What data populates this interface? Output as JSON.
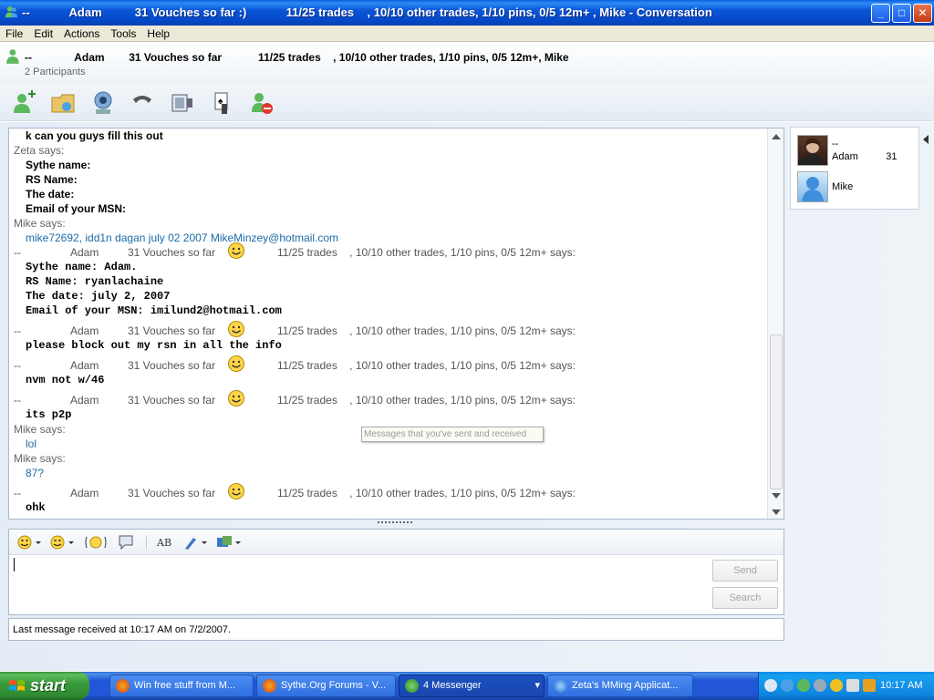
{
  "window": {
    "title": "--            Adam          31 Vouches so far :)            11/25 trades    , 10/10 other trades, 1/10 pins, 0/5 12m+ , Mike - Conversation",
    "controls": {
      "minimize": "_",
      "maximize": "□",
      "close": "✕"
    }
  },
  "menu": [
    "File",
    "Edit",
    "Actions",
    "Tools",
    "Help"
  ],
  "header": {
    "title": "--              Adam        31 Vouches so far            11/25 trades    , 10/10 other trades, 1/10 pins, 0/5 12m+, Mike",
    "participants": "2 Participants"
  },
  "toolbar": [
    {
      "name": "invite-contact-icon"
    },
    {
      "name": "send-files-icon"
    },
    {
      "name": "video-call-icon"
    },
    {
      "name": "phone-call-icon"
    },
    {
      "name": "activities-icon"
    },
    {
      "name": "games-icon"
    },
    {
      "name": "block-contact-icon"
    }
  ],
  "chat": {
    "lines": [
      {
        "kind": "msg-bold",
        "text": "k can you guys fill this out"
      },
      {
        "kind": "says",
        "text": "Zeta says:"
      },
      {
        "kind": "msg-bold",
        "text": "Sythe name:"
      },
      {
        "kind": "msg-bold",
        "text": "RS Name:"
      },
      {
        "kind": "msg-bold",
        "text": "The date:"
      },
      {
        "kind": "msg-bold",
        "text": "Email of your MSN:"
      },
      {
        "kind": "says",
        "text": "Mike says:"
      },
      {
        "kind": "msg-blue",
        "text": "mike72692, idd1n dagan july 02 2007 MikeMinzey@hotmail.com"
      },
      {
        "kind": "hdr"
      },
      {
        "kind": "msg-mono",
        "text": "Sythe name: Adam."
      },
      {
        "kind": "msg-mono",
        "text": "RS Name: ryanlachaine"
      },
      {
        "kind": "msg-mono",
        "text": "The date: july 2, 2007"
      },
      {
        "kind": "msg-mono",
        "text": "Email of your MSN: imilund2@hotmail.com"
      },
      {
        "kind": "hdr",
        "gap": true
      },
      {
        "kind": "msg-mono",
        "text": "please block out my rsn in all the info"
      },
      {
        "kind": "hdr",
        "gap": true
      },
      {
        "kind": "msg-mono",
        "text": "nvm not w/46"
      },
      {
        "kind": "hdr",
        "gap": true
      },
      {
        "kind": "msg-mono",
        "text": "its p2p"
      },
      {
        "kind": "says",
        "text": "Mike says:"
      },
      {
        "kind": "msg-blue",
        "text": "lol"
      },
      {
        "kind": "says",
        "text": "Mike says:"
      },
      {
        "kind": "msg-blue",
        "text": "87?"
      },
      {
        "kind": "hdr",
        "gap": true
      },
      {
        "kind": "msg-mono",
        "text": "ohk"
      }
    ],
    "sender_header": {
      "dash": "--",
      "name": "Adam",
      "vouches": "31 Vouches so far",
      "rest": "11/25 trades    , 10/10 other trades, 1/10 pins, 0/5 12m+ says:"
    },
    "tooltip": "Messages that you've sent and received"
  },
  "compose": {
    "send_label": "Send",
    "search_label": "Search"
  },
  "status": "Last message received at 10:17 AM on 7/2/2007.",
  "contacts": {
    "adam": {
      "line1": "--",
      "line2": "Adam          31"
    },
    "mike": {
      "name": "Mike"
    }
  },
  "taskbar": {
    "start_label": "start",
    "tasks": [
      {
        "label": "Win free stuff from M..."
      },
      {
        "label": "Sythe.Org Forums - V..."
      },
      {
        "label": "4 Messenger"
      },
      {
        "label": "Zeta's MMing Applicat..."
      }
    ],
    "clock": "10:17 AM"
  }
}
